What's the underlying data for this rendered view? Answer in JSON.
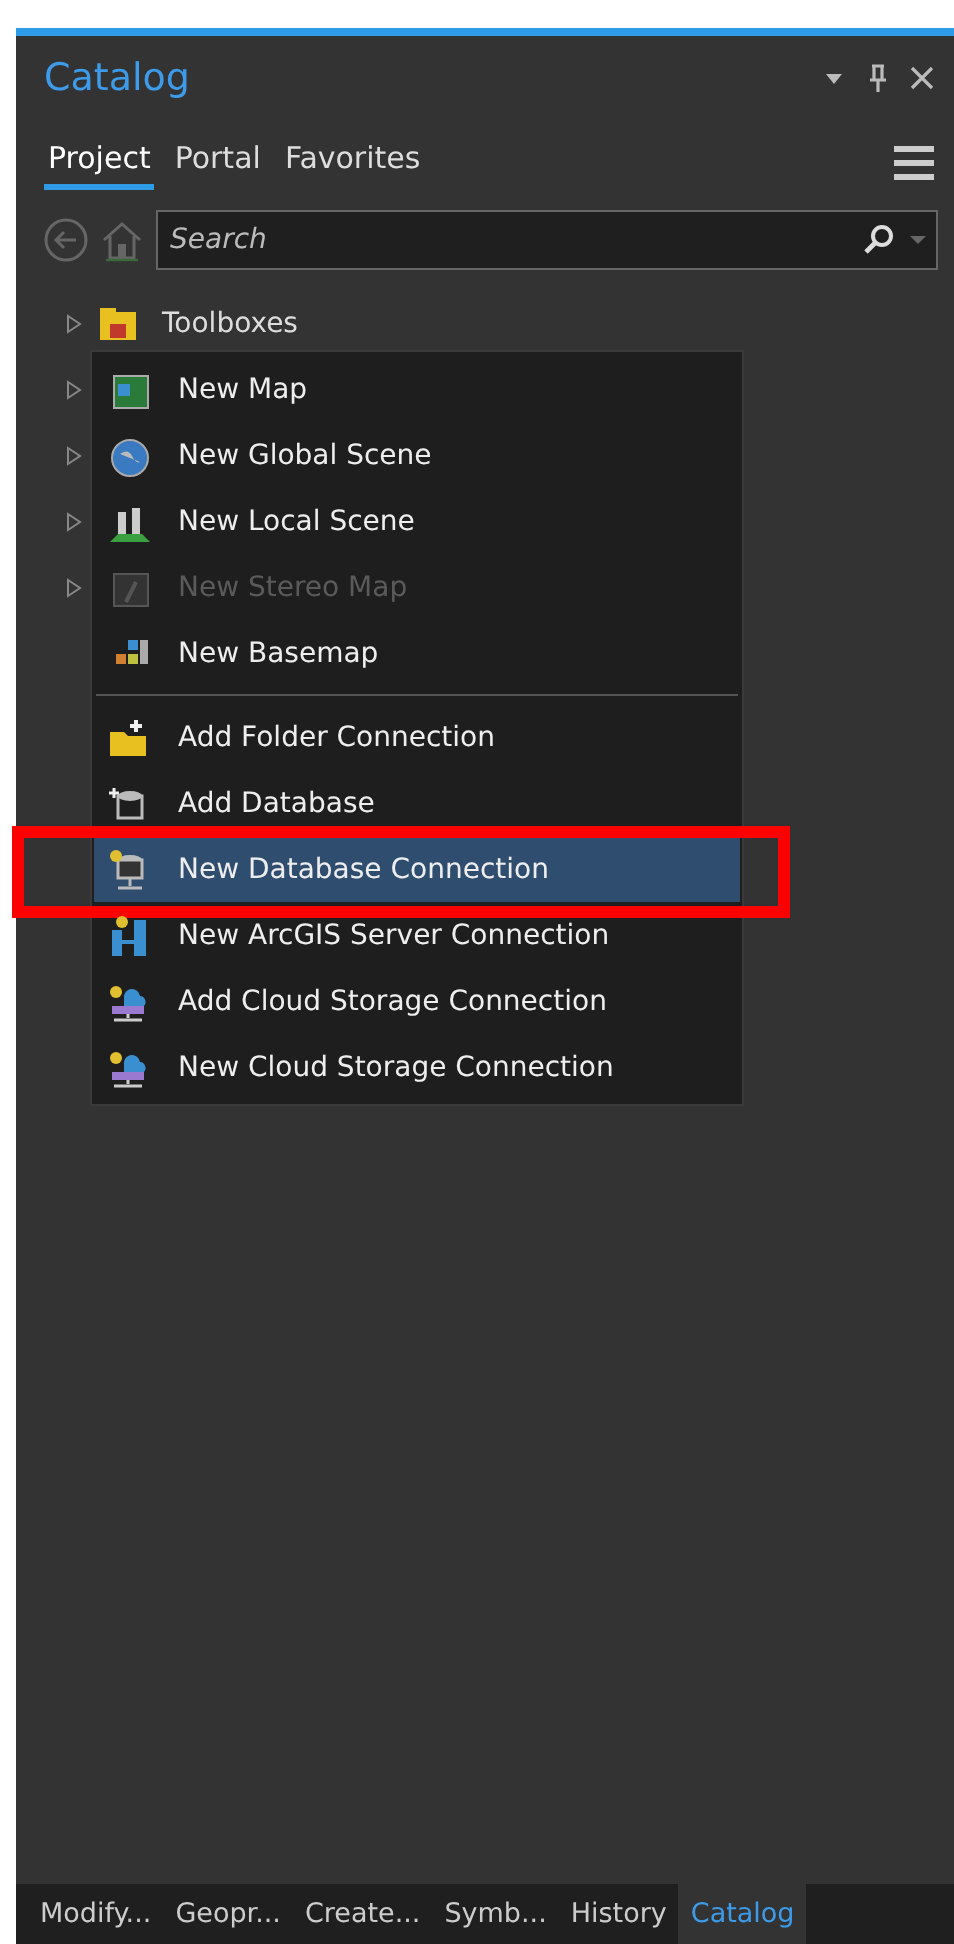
{
  "pane": {
    "title": "Catalog"
  },
  "tabs": [
    {
      "label": "Project",
      "selected": true
    },
    {
      "label": "Portal",
      "selected": false
    },
    {
      "label": "Favorites",
      "selected": false
    }
  ],
  "search": {
    "placeholder": "Search"
  },
  "tree": [
    {
      "label": "Toolboxes",
      "expanded": false
    },
    {
      "expanded": false
    },
    {
      "expanded": false
    },
    {
      "expanded": false
    },
    {
      "expanded": false
    }
  ],
  "menu": [
    {
      "kind": "item",
      "label": "New Map",
      "disabled": false,
      "selected": false,
      "annotated": false
    },
    {
      "kind": "item",
      "label": "New Global Scene",
      "disabled": false,
      "selected": false,
      "annotated": false
    },
    {
      "kind": "item",
      "label": "New Local Scene",
      "disabled": false,
      "selected": false,
      "annotated": false
    },
    {
      "kind": "item",
      "label": "New Stereo Map",
      "disabled": true,
      "selected": false,
      "annotated": false
    },
    {
      "kind": "item",
      "label": "New Basemap",
      "disabled": false,
      "selected": false,
      "annotated": false
    },
    {
      "kind": "separator"
    },
    {
      "kind": "item",
      "label": "Add Folder Connection",
      "disabled": false,
      "selected": false,
      "annotated": false
    },
    {
      "kind": "item",
      "label": "Add Database",
      "disabled": false,
      "selected": false,
      "annotated": false
    },
    {
      "kind": "item",
      "label": "New Database Connection",
      "disabled": false,
      "selected": true,
      "annotated": true
    },
    {
      "kind": "item",
      "label": "New ArcGIS Server Connection",
      "disabled": false,
      "selected": false,
      "annotated": false
    },
    {
      "kind": "item",
      "label": "Add Cloud Storage Connection",
      "disabled": false,
      "selected": false,
      "annotated": false
    },
    {
      "kind": "item",
      "label": "New Cloud Storage Connection",
      "disabled": false,
      "selected": false,
      "annotated": false
    }
  ],
  "bottom_tabs": [
    {
      "label": "Modify...",
      "selected": false
    },
    {
      "label": "Geopr...",
      "selected": false
    },
    {
      "label": "Create...",
      "selected": false
    },
    {
      "label": "Symb...",
      "selected": false
    },
    {
      "label": "History",
      "selected": false
    },
    {
      "label": "Catalog",
      "selected": true
    }
  ]
}
